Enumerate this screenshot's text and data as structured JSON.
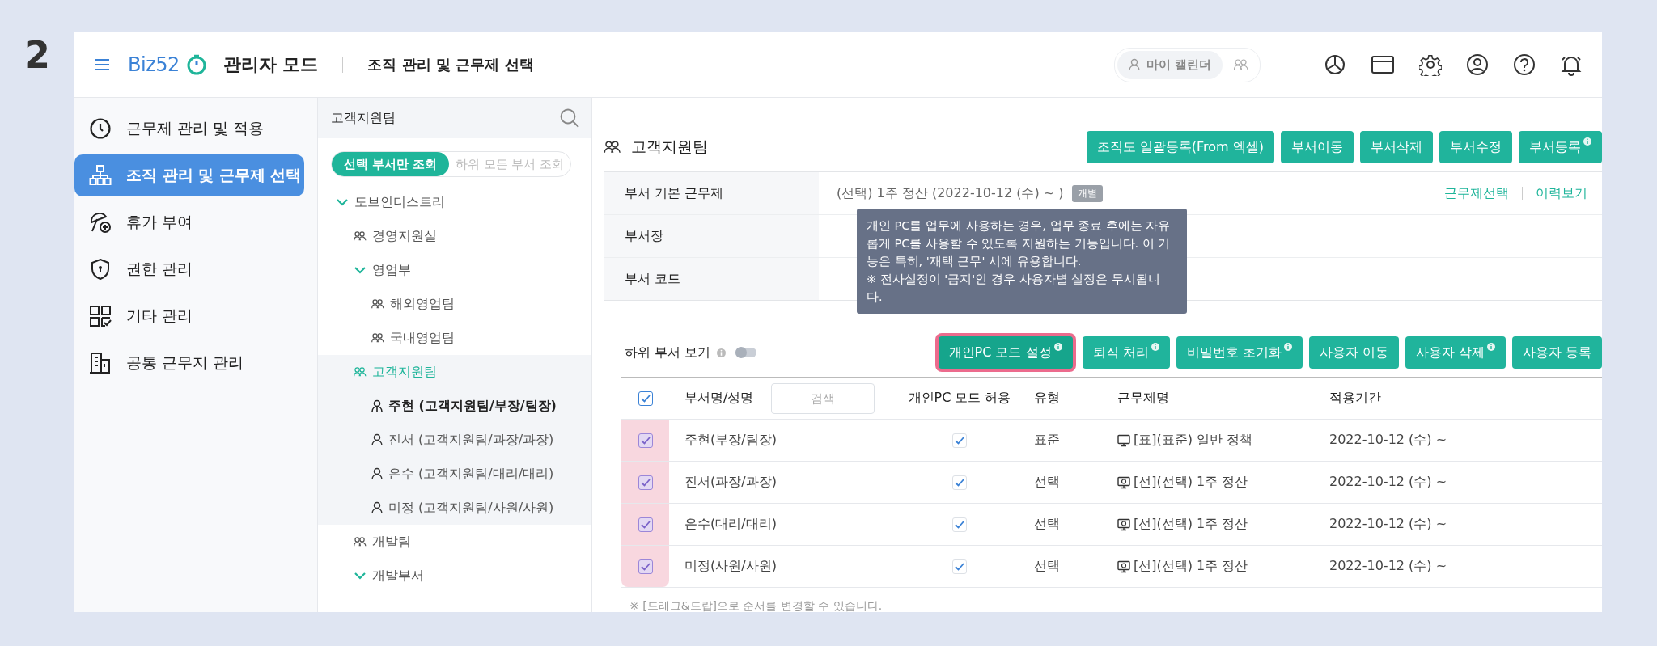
{
  "step_number": "2",
  "header": {
    "logo": "Biz52",
    "app_name": "관리자 모드",
    "page_title": "조직 관리 및 근무제 선택",
    "calendar_button": "마이 캘린더"
  },
  "sidebar": {
    "items": [
      {
        "label": "근무제 관리 및 적용",
        "selected": false
      },
      {
        "label": "조직 관리 및 근무제 선택",
        "selected": true
      },
      {
        "label": "휴가 부여",
        "selected": false
      },
      {
        "label": "권한 관리",
        "selected": false
      },
      {
        "label": "기타 관리",
        "selected": false
      },
      {
        "label": "공통 근무지 관리",
        "selected": false
      }
    ]
  },
  "tree": {
    "title": "고객지원팀",
    "scope_toggle": [
      {
        "label": "선택 부서만 조회",
        "selected": true
      },
      {
        "label": "하위 모든 부서 조회",
        "selected": false
      }
    ],
    "nodes": [
      {
        "kind": "folder",
        "label": "도브인더스트리",
        "expanded": true,
        "selected": false,
        "children": [
          {
            "kind": "team",
            "label": "경영지원실",
            "selected": false
          },
          {
            "kind": "folder",
            "label": "영업부",
            "expanded": true,
            "selected": false,
            "children": [
              {
                "kind": "team",
                "label": "해외영업팀",
                "selected": false
              },
              {
                "kind": "team",
                "label": "국내영업팀",
                "selected": false
              }
            ]
          },
          {
            "kind": "team",
            "label": "고객지원팀",
            "selected": true,
            "children": [
              {
                "kind": "leader",
                "label": "주현 (고객지원팀/부장/팀장)",
                "selected": false
              },
              {
                "kind": "person",
                "label": "진서 (고객지원팀/과장/과장)",
                "selected": false
              },
              {
                "kind": "person",
                "label": "은수 (고객지원팀/대리/대리)",
                "selected": false
              },
              {
                "kind": "person",
                "label": "미정 (고객지원팀/사원/사원)",
                "selected": false
              }
            ]
          },
          {
            "kind": "team",
            "label": "개발팀",
            "selected": false
          },
          {
            "kind": "folder",
            "label": "개발부서",
            "expanded": true,
            "selected": false
          }
        ]
      }
    ]
  },
  "department": {
    "title": "고객지원팀",
    "buttons": [
      {
        "label": "조직도 일괄등록(From 엑셀)",
        "info": false
      },
      {
        "label": "부서이동",
        "info": false
      },
      {
        "label": "부서삭제",
        "info": false
      },
      {
        "label": "부서수정",
        "info": false
      },
      {
        "label": "부서등록",
        "info": true
      }
    ],
    "info_rows": [
      {
        "label": "부서 기본 근무제",
        "value": "(선택) 1주 정산 (2022-10-12 (수) ~ )",
        "tag": "개별",
        "links": [
          "근무제선택",
          "이력보기"
        ]
      },
      {
        "label": "부서장"
      },
      {
        "label": "부서 코드"
      }
    ]
  },
  "tooltip": {
    "lines": [
      "개인 PC를 업무에 사용하는 경우, 업무 종료 후에는 자유",
      "롭게 PC를 사용할 수 있도록 지원하는 기능입니다. 이 기",
      "능은 특히, '재택 근무' 시에 유용합니다.",
      "※ 전사설정이 '금지'인 경우 사용자별 설정은 무시됩니",
      "다."
    ]
  },
  "subdept_toggle": {
    "label": "하위 부서 보기",
    "on": false
  },
  "user_buttons": [
    {
      "label": "개인PC 모드 설정",
      "info": true,
      "highlighted": true
    },
    {
      "label": "퇴직 처리",
      "info": true,
      "highlighted": false
    },
    {
      "label": "비밀번호 초기화",
      "info": true,
      "highlighted": false
    },
    {
      "label": "사용자 이동",
      "info": false,
      "highlighted": false
    },
    {
      "label": "사용자 삭제",
      "info": true,
      "highlighted": false
    },
    {
      "label": "사용자 등록",
      "info": false,
      "highlighted": false
    }
  ],
  "table": {
    "all_checked": true,
    "search_placeholder": "검색",
    "columns": [
      "부서명/성명",
      "개인PC 모드 허용",
      "유형",
      "근무제명",
      "적용기간"
    ],
    "rows": [
      {
        "name": "주현(부장/팀장)",
        "checked": true,
        "highlighted": true,
        "pc_allowed": true,
        "type": "표준",
        "kind": "standard",
        "policy": "[표](표준) 일반 정책",
        "period": "2022-10-12 (수) ~"
      },
      {
        "name": "진서(과장/과장)",
        "checked": true,
        "highlighted": true,
        "pc_allowed": true,
        "type": "선택",
        "kind": "flex",
        "policy": "[선](선택) 1주 정산",
        "period": "2022-10-12 (수) ~"
      },
      {
        "name": "은수(대리/대리)",
        "checked": true,
        "highlighted": true,
        "pc_allowed": true,
        "type": "선택",
        "kind": "flex",
        "policy": "[선](선택) 1주 정산",
        "period": "2022-10-12 (수) ~"
      },
      {
        "name": "미정(사원/사원)",
        "checked": true,
        "highlighted": true,
        "pc_allowed": true,
        "type": "선택",
        "kind": "flex",
        "policy": "[선](선택) 1주 정산",
        "period": "2022-10-12 (수) ~"
      }
    ],
    "footnote": "※ [드래그&드랍]으로 순서를 변경할 수 있습니다."
  }
}
